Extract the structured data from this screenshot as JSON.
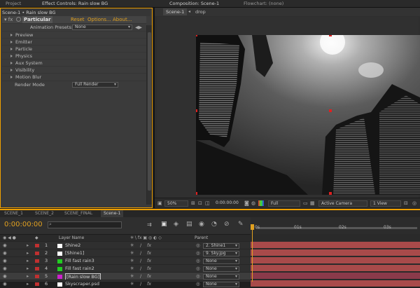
{
  "top_tabs": {
    "project": "Project",
    "effect_controls": "Effect Controls: Rain slow BG",
    "composition": "Composition: Scene-1",
    "flowchart": "Flowchart: (none)"
  },
  "effect_controls": {
    "breadcrumb": "Scene-1 • Rain slow BG",
    "effect_name": "Particular",
    "reset": "Reset",
    "options": "Options...",
    "about": "About...",
    "animation_presets_label": "Animation Presets:",
    "animation_presets_value": "None",
    "groups": [
      "Preview",
      "Emitter",
      "Particle",
      "Physics",
      "Aux System",
      "Visibility",
      "Motion Blur"
    ],
    "render_mode_label": "Render Mode",
    "render_mode_value": "Full Render"
  },
  "composition": {
    "tab": "Scene-1",
    "drop": "drop",
    "zoom": "50%",
    "timecode": "0:00:00:00",
    "resolution": "Full",
    "camera": "Active Camera",
    "views": "1 View"
  },
  "timeline": {
    "tabs": [
      "SCENE_1",
      "SCENE_2",
      "SCENE_FINAL",
      "Scene-1"
    ],
    "timecode": "0:00:00:00",
    "col_layer_name": "Layer Name",
    "col_parent": "Parent",
    "ruler": [
      "0s",
      "01s",
      "02s",
      "03s"
    ],
    "layers": [
      {
        "num": "1",
        "name": "Shine2",
        "color": "#ffffff",
        "label": "#c03030",
        "parent": "2. Shine1"
      },
      {
        "num": "2",
        "name": "[Shine1]",
        "color": "#ffffff",
        "label": "#c03030",
        "parent": "9. Sky.jpg"
      },
      {
        "num": "3",
        "name": "Fill fast rain3",
        "color": "#22cc22",
        "label": "#c03030",
        "parent": "None"
      },
      {
        "num": "4",
        "name": "Fill fast rain2",
        "color": "#22cc22",
        "label": "#c03030",
        "parent": "None"
      },
      {
        "num": "5",
        "name": "[Rain slow BG]",
        "color": "#cc22cc",
        "label": "#c03030",
        "parent": "None"
      },
      {
        "num": "6",
        "name": "Skyscraper.psd",
        "color": "#ffffff",
        "label": "#c03030",
        "parent": "None"
      }
    ]
  },
  "colors": {
    "accent": "#f0a000",
    "layer_bar": "#a84a4a"
  }
}
